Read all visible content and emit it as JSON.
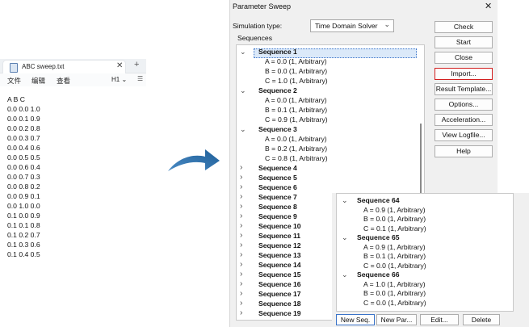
{
  "notepad": {
    "tab_title": "ABC sweep.txt",
    "close_glyph": "✕",
    "new_tab_glyph": "+",
    "menus": [
      "文件",
      "编辑",
      "查看"
    ],
    "heading_selector": "H1 ⌄",
    "list_glyph": "☰",
    "lines": [
      "A B C",
      "0.0 0.0 1.0",
      "0.0 0.1 0.9",
      "0.0 0.2 0.8",
      "0.0 0.3 0.7",
      "0.0 0.4 0.6",
      "0.0 0.5 0.5",
      "0.0 0.6 0.4",
      "0.0 0.7 0.3",
      "0.0 0.8 0.2",
      "0.0 0.9 0.1",
      "0.0 1.0 0.0",
      "0.1 0.0 0.9",
      "0.1 0.1 0.8",
      "0.1 0.2 0.7",
      "0.1 0.3 0.6",
      "0.1 0.4 0.5"
    ]
  },
  "dialog": {
    "title": "Parameter Sweep",
    "close_glyph": "✕",
    "sim_type_label": "Simulation type:",
    "sim_type_value": "Time Domain Solver",
    "sequences_label": "Sequences",
    "tree": [
      {
        "label": "Sequence 1",
        "expanded": true,
        "selected": true,
        "params": [
          "A = 0.0 (1, Arbitrary)",
          "B = 0.0 (1, Arbitrary)",
          "C = 1.0 (1, Arbitrary)"
        ]
      },
      {
        "label": "Sequence 2",
        "expanded": true,
        "params": [
          "A = 0.0 (1, Arbitrary)",
          "B = 0.1 (1, Arbitrary)",
          "C = 0.9 (1, Arbitrary)"
        ]
      },
      {
        "label": "Sequence 3",
        "expanded": true,
        "params": [
          "A = 0.0 (1, Arbitrary)",
          "B = 0.2 (1, Arbitrary)",
          "C = 0.8 (1, Arbitrary)"
        ]
      },
      {
        "label": "Sequence 4"
      },
      {
        "label": "Sequence 5"
      },
      {
        "label": "Sequence 6"
      },
      {
        "label": "Sequence 7"
      },
      {
        "label": "Sequence 8"
      },
      {
        "label": "Sequence 9"
      },
      {
        "label": "Sequence 10"
      },
      {
        "label": "Sequence 11"
      },
      {
        "label": "Sequence 12"
      },
      {
        "label": "Sequence 13"
      },
      {
        "label": "Sequence 14"
      },
      {
        "label": "Sequence 15"
      },
      {
        "label": "Sequence 16"
      },
      {
        "label": "Sequence 17"
      },
      {
        "label": "Sequence 18"
      },
      {
        "label": "Sequence 19"
      }
    ],
    "buttons": [
      "Check",
      "Start",
      "Close",
      "Import...",
      "Result Template...",
      "Options...",
      "Acceleration...",
      "View Logfile...",
      "Help"
    ],
    "highlighted_button": "Import...",
    "expanded_glyph": "⌄",
    "collapsed_glyph": "›"
  },
  "overlay": {
    "tree": [
      {
        "label": "Sequence 64",
        "params": [
          "A = 0.9 (1, Arbitrary)",
          "B = 0.0 (1, Arbitrary)",
          "C = 0.1 (1, Arbitrary)"
        ]
      },
      {
        "label": "Sequence 65",
        "params": [
          "A = 0.9 (1, Arbitrary)",
          "B = 0.1 (1, Arbitrary)",
          "C = 0.0 (1, Arbitrary)"
        ]
      },
      {
        "label": "Sequence 66",
        "params": [
          "A = 1.0 (1, Arbitrary)",
          "B = 0.0 (1, Arbitrary)",
          "C = 0.0 (1, Arbitrary)"
        ]
      }
    ],
    "buttons": [
      "New Seq.",
      "New Par...",
      "Edit...",
      "Delete"
    ]
  },
  "colors": {
    "highlight_border": "#d21e1e",
    "arrow": "#2f6fa8",
    "selection_fill": "#dbe9f9"
  }
}
